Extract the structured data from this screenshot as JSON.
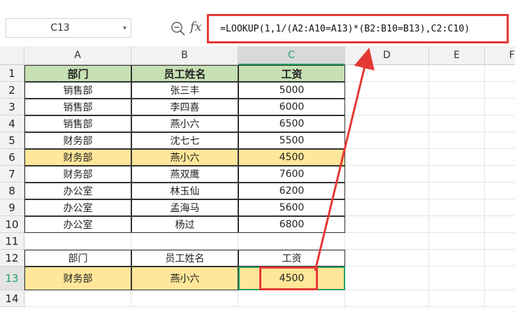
{
  "name_box": {
    "ref": "C13"
  },
  "formula_bar": {
    "formula": "=LOOKUP(1,1/(A2:A10=A13)*(B2:B10=B13),C2:C10)",
    "fx_label": "fx"
  },
  "columns": [
    "A",
    "B",
    "C",
    "D",
    "E",
    "F"
  ],
  "rows": [
    "1",
    "2",
    "3",
    "4",
    "5",
    "6",
    "7",
    "8",
    "9",
    "10",
    "11",
    "12",
    "13",
    "14"
  ],
  "table": {
    "headers": [
      "部门",
      "员工姓名",
      "工资"
    ],
    "data": [
      [
        "销售部",
        "张三丰",
        "5000"
      ],
      [
        "销售部",
        "李四喜",
        "6000"
      ],
      [
        "销售部",
        "燕小六",
        "6500"
      ],
      [
        "财务部",
        "沈七七",
        "5500"
      ],
      [
        "财务部",
        "燕小六",
        "4500"
      ],
      [
        "财务部",
        "燕双鹰",
        "7600"
      ],
      [
        "办公室",
        "林玉仙",
        "6200"
      ],
      [
        "办公室",
        "孟海马",
        "5600"
      ],
      [
        "办公室",
        "杨过",
        "6800"
      ]
    ]
  },
  "lookup": {
    "headers": [
      "部门",
      "员工姓名",
      "工资"
    ],
    "values": [
      "财务部",
      "燕小六",
      "4500"
    ]
  },
  "colors": {
    "header_fill": "#c6e0b4",
    "highlight_fill": "#ffe699",
    "accent": "#21a366",
    "annotation_red": "#e53935"
  }
}
